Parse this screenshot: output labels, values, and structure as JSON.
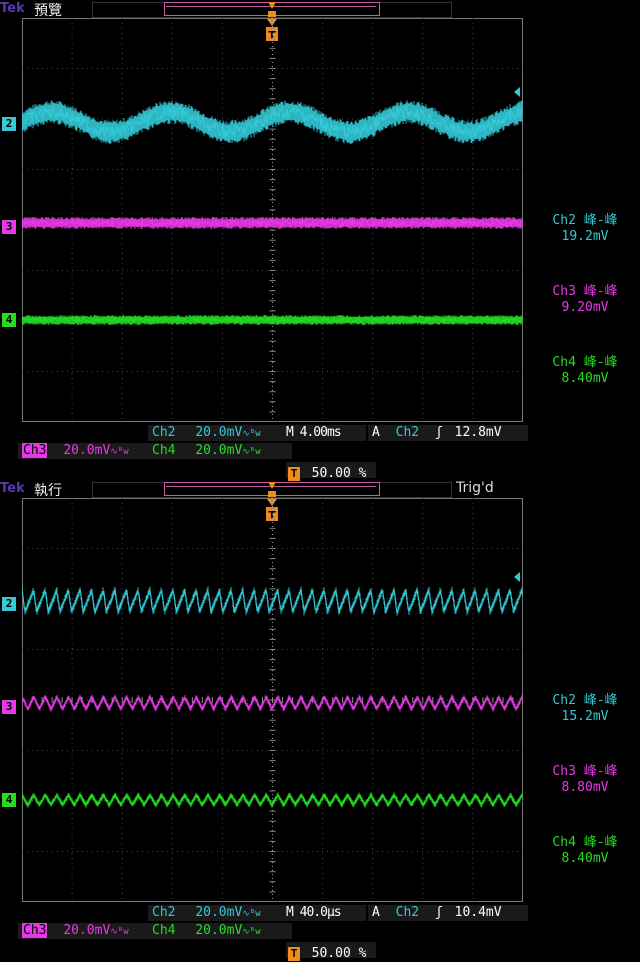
{
  "colors": {
    "ch2": "#33c9d6",
    "ch3": "#e63ae6",
    "ch4": "#22dd22",
    "orange": "#f08a1a",
    "grid": "#555555"
  },
  "panels": [
    {
      "logo": "Tek",
      "status": "預覽",
      "trig_state": "",
      "markers": {
        "ch2": "2",
        "ch3": "3",
        "ch4": "4"
      },
      "measurements": [
        {
          "label": "Ch2 峰-峰",
          "value": "19.2mV"
        },
        {
          "label": "Ch3 峰-峰",
          "value": "9.20mV"
        },
        {
          "label": "Ch4 峰-峰",
          "value": "8.40mV"
        }
      ],
      "readout": {
        "ch2_label": "Ch2",
        "ch2_scale": "20.0mV",
        "ch3_label": "Ch3",
        "ch3_scale": "20.0mV",
        "ch4_label": "Ch4",
        "ch4_scale": "20.0mV",
        "bw_symbol": "∿ᴮw",
        "timebase": "M 4.00ms",
        "trig_mode": "A",
        "trig_source": "Ch2",
        "trig_slope": "ʃ",
        "trig_level": "12.8mV",
        "trig_position": "50.00 %",
        "t_marker": "T"
      }
    },
    {
      "logo": "Tek",
      "status": "執行",
      "trig_state": "Trig'd",
      "markers": {
        "ch2": "2",
        "ch3": "3",
        "ch4": "4"
      },
      "measurements": [
        {
          "label": "Ch2 峰-峰",
          "value": "15.2mV"
        },
        {
          "label": "Ch3 峰-峰",
          "value": "8.80mV"
        },
        {
          "label": "Ch4 峰-峰",
          "value": "8.40mV"
        }
      ],
      "readout": {
        "ch2_label": "Ch2",
        "ch2_scale": "20.0mV",
        "ch3_label": "Ch3",
        "ch3_scale": "20.0mV",
        "ch4_label": "Ch4",
        "ch4_scale": "20.0mV",
        "bw_symbol": "∿ᴮw",
        "timebase": "M 40.0µs",
        "trig_mode": "A",
        "trig_source": "Ch2",
        "trig_slope": "ʃ",
        "trig_level": "10.4mV",
        "trig_position": "50.00 %",
        "t_marker": "T"
      }
    }
  ]
}
